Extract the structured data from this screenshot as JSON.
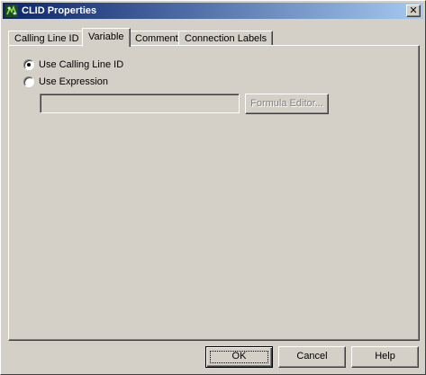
{
  "window": {
    "title": "CLID Properties",
    "close_glyph": "✕"
  },
  "tabs": [
    {
      "label": "Calling Line ID",
      "active": false
    },
    {
      "label": "Variable",
      "active": true
    },
    {
      "label": "Comment",
      "active": false
    },
    {
      "label": "Connection Labels",
      "active": false
    }
  ],
  "panel": {
    "radio_calling_line": {
      "label": "Use Calling Line ID",
      "checked": true
    },
    "radio_expression": {
      "label": "Use Expression",
      "checked": false
    },
    "expression_value": "",
    "formula_editor_label": "Formula Editor..."
  },
  "buttons": {
    "ok": "OK",
    "cancel": "Cancel",
    "help": "Help"
  },
  "colors": {
    "face": "#d4d0c8",
    "title_start": "#0a246a",
    "title_end": "#a6caf0"
  },
  "icons": {
    "app": "app-icon",
    "close": "close-icon"
  }
}
